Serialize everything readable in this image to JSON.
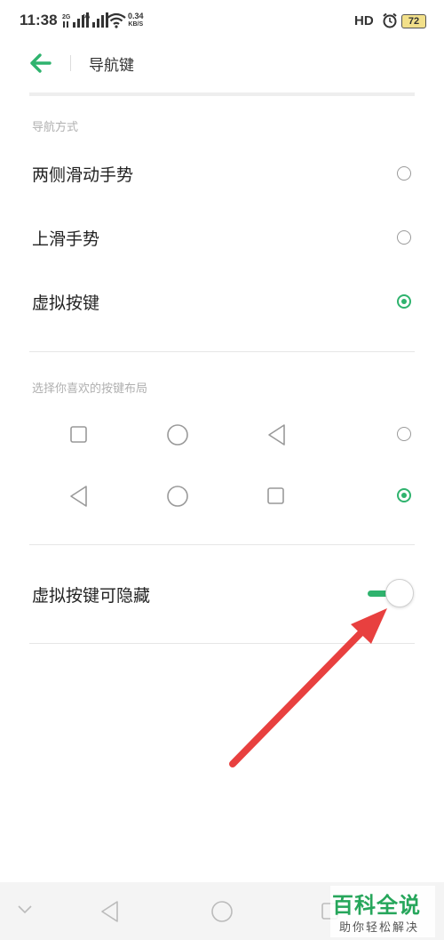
{
  "status_bar": {
    "time": "11:38",
    "network_1": "2G",
    "network_2": "4G",
    "speed_value": "0.34",
    "speed_unit": "KB/S",
    "hd_label": "HD",
    "battery": "72"
  },
  "app_bar": {
    "title": "导航键"
  },
  "nav_mode": {
    "section_label": "导航方式",
    "options": [
      {
        "label": "两侧滑动手势",
        "selected": false
      },
      {
        "label": "上滑手势",
        "selected": false
      },
      {
        "label": "虚拟按键",
        "selected": true
      }
    ]
  },
  "layout": {
    "section_label": "选择你喜欢的按键布局",
    "options": [
      {
        "icons": [
          "square-icon",
          "circle-icon",
          "triangle-left-icon"
        ],
        "selected": false
      },
      {
        "icons": [
          "triangle-left-icon",
          "circle-icon",
          "square-icon"
        ],
        "selected": true
      }
    ]
  },
  "hide_keys": {
    "label": "虚拟按键可隐藏",
    "enabled": true
  },
  "colors": {
    "accent": "#2fb36e",
    "arrow": "#e8403f"
  },
  "watermark": {
    "main": "百科全说",
    "sub": "助你轻松解决"
  }
}
